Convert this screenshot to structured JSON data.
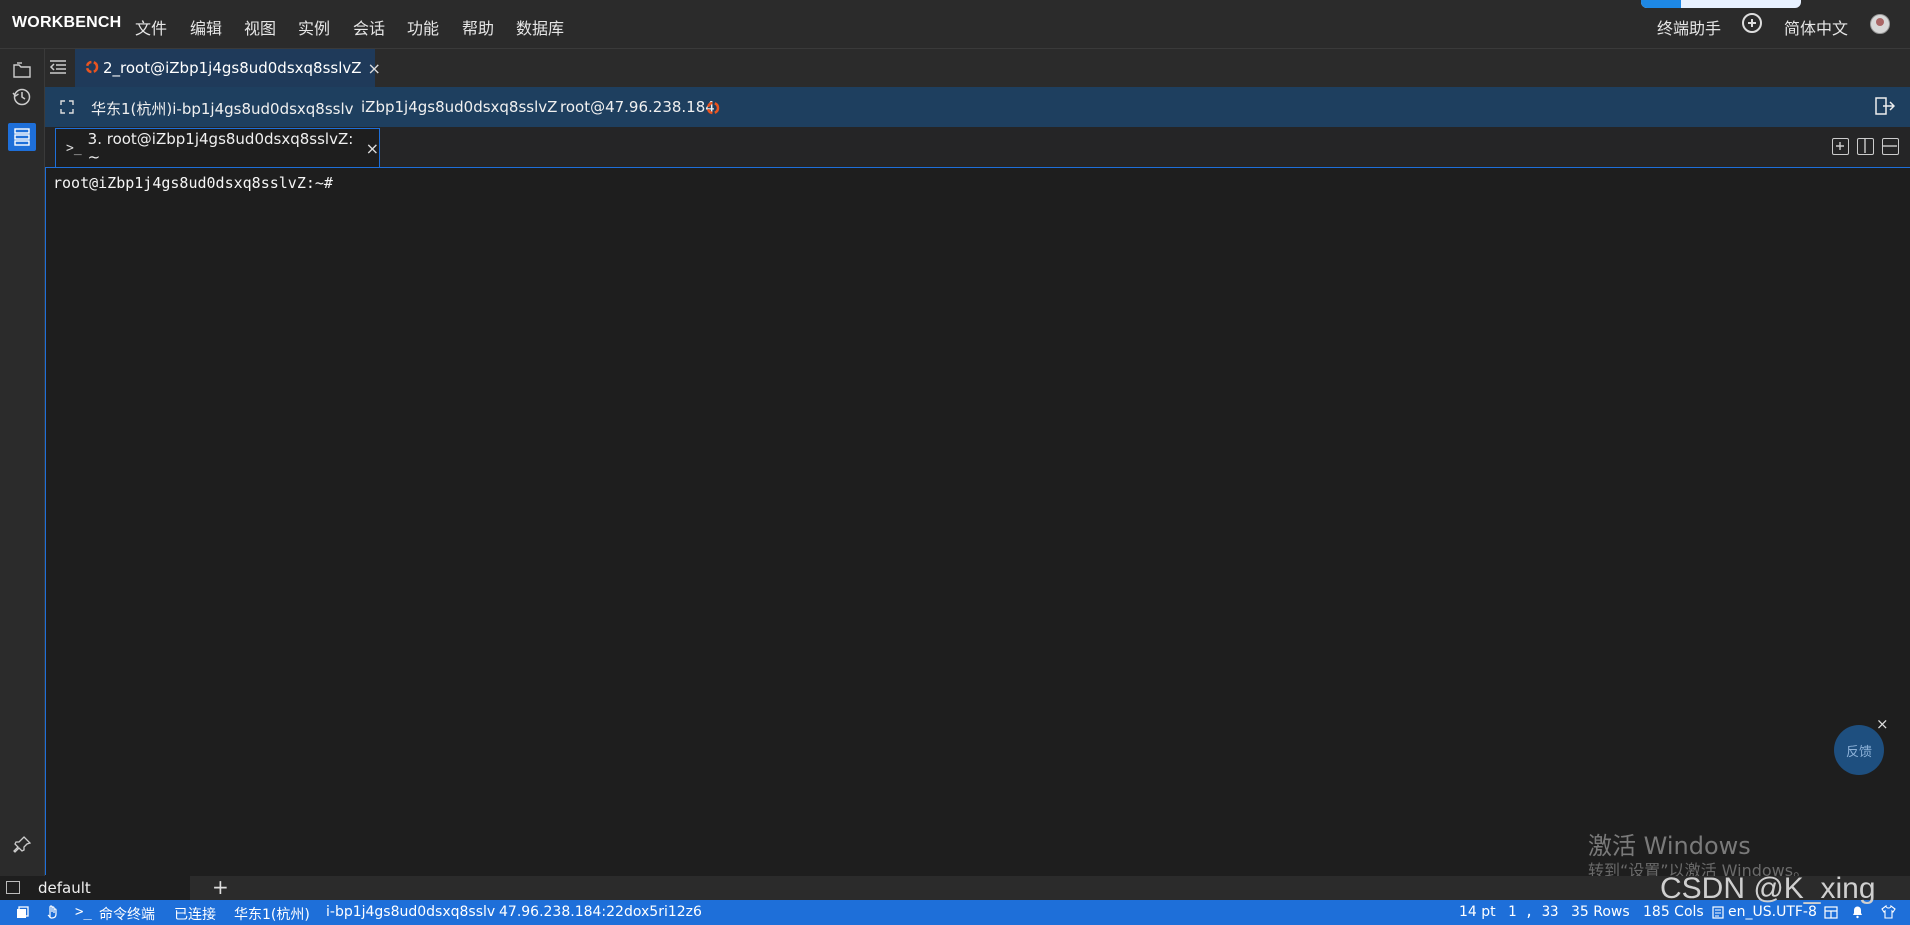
{
  "app": {
    "brand": "WORKBENCH"
  },
  "menu": [
    "文件",
    "编辑",
    "视图",
    "实例",
    "会话",
    "功能",
    "帮助",
    "数据库"
  ],
  "top_right": {
    "assistant": "终端助手",
    "language": "简体中文",
    "progress": 0.25
  },
  "session_tab": {
    "label": "2_root@iZbp1j4gs8ud0dsxq8sslvZ",
    "close": "×"
  },
  "info_bar": {
    "region_instance": "华东1(杭州)i-bp1j4gs8ud0dsxq8sslv",
    "hostname": "iZbp1j4gs8ud0dsxq8sslvZ",
    "user_ip": "root@47.96.238.184"
  },
  "terminal_tab": {
    "icon": ">_",
    "label": "3. root@iZbp1j4gs8ud0dsxq8sslvZ: ~",
    "close": "×"
  },
  "terminal": {
    "prompt": "root@iZbp1j4gs8ud0dsxq8sslvZ:~#"
  },
  "feedback": {
    "label": "反馈",
    "close": "×"
  },
  "watermark": {
    "line1": "激活 Windows",
    "line2": "转到“设置”以激活 Windows。",
    "csdn": "CSDN @K_xing"
  },
  "panel": {
    "tab_label": "default",
    "add": "+"
  },
  "status": {
    "mode_icon": ">_",
    "mode": "命令终端",
    "connection": "已连接",
    "region": "华东1(杭州)",
    "instance": "i-bp1j4gs8ud0dsxq8sslv",
    "address": "47.96.238.184:22",
    "session_id": "dox5ri12z6",
    "font_size": "14 pt",
    "cursor": "1 , 33",
    "rows": "35 Rows",
    "cols": "185 Cols",
    "encoding": "en_US.UTF-8"
  },
  "colors": {
    "accent": "#1e6fd9",
    "info_bar": "#1e3f5f",
    "ubuntu_orange": "#e95420"
  },
  "icons": [
    "files-icon",
    "history-icon",
    "sessions-icon",
    "pin-icon",
    "collapse-sidebar-icon",
    "ubuntu-icon",
    "fullscreen-icon",
    "exit-icon",
    "new-terminal-icon",
    "split-vertical-icon",
    "split-horizontal-icon"
  ]
}
